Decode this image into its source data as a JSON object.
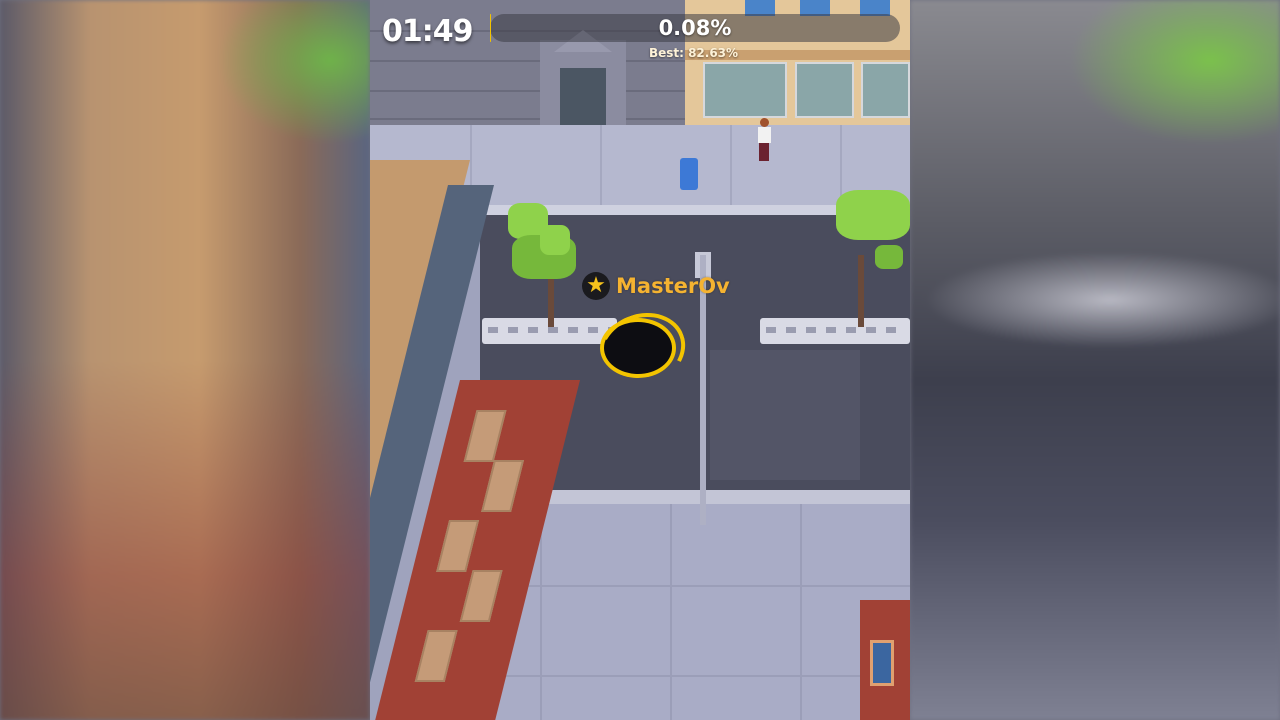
{
  "hud": {
    "timer": "01:49",
    "progress_text": "0.08%",
    "progress_fraction": 0.0008,
    "best_text": "Best: 82.63%"
  },
  "player": {
    "name": "MasterOv",
    "badge_icon": "star-icon",
    "hole_color": "#f3c400"
  },
  "colors": {
    "accent": "#f3c400",
    "name_color": "#f5b331"
  }
}
